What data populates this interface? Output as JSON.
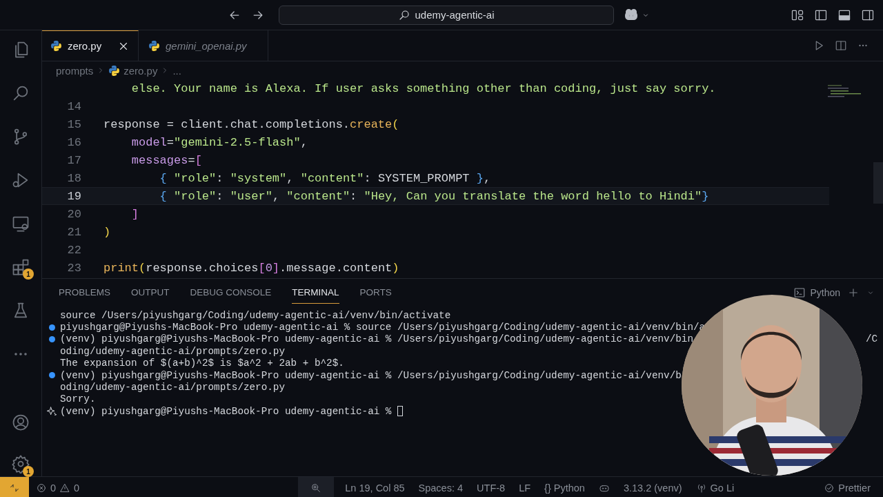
{
  "title_bar": {
    "search": "udemy-agentic-ai"
  },
  "activity_bar": {
    "items": [
      {
        "kind": "files",
        "selected": false
      },
      {
        "kind": "search",
        "selected": false
      },
      {
        "kind": "source-control",
        "selected": false
      },
      {
        "kind": "run",
        "selected": false
      },
      {
        "kind": "remote",
        "selected": false
      },
      {
        "kind": "extensions",
        "selected": false,
        "badge": "1"
      },
      {
        "kind": "testing",
        "selected": false
      },
      {
        "kind": "more",
        "selected": false
      }
    ],
    "bottom": [
      {
        "kind": "account"
      },
      {
        "kind": "settings",
        "badge": "1"
      }
    ]
  },
  "tabs": [
    {
      "label": "zero.py",
      "selected": true,
      "preview": false
    },
    {
      "label": "gemini_openai.py",
      "selected": false,
      "preview": true
    }
  ],
  "breadcrumb": [
    "prompts",
    "zero.py",
    "..."
  ],
  "editor": {
    "lines": [
      {
        "current": false,
        "tokens": [
          {
            "kind": "str",
            "text": "    else. Your name is Alexa. If user asks something other than coding, just say sorry."
          }
        ]
      },
      {
        "number": "14",
        "current": false
      },
      {
        "number": "15",
        "current": false,
        "tokens": [
          {
            "kind": "plain",
            "text": "response = client.chat.completions."
          },
          {
            "kind": "fn",
            "text": "create"
          },
          {
            "kind": "b1",
            "text": "("
          }
        ]
      },
      {
        "number": "16",
        "current": false,
        "tokens": [
          {
            "kind": "param",
            "text": "    model"
          },
          {
            "kind": "plain",
            "text": "="
          },
          {
            "kind": "str",
            "text": "\"gemini-2.5-flash\""
          },
          {
            "kind": "plain",
            "text": ","
          }
        ]
      },
      {
        "number": "17",
        "current": false,
        "tokens": [
          {
            "kind": "param",
            "text": "    messages"
          },
          {
            "kind": "plain",
            "text": "="
          },
          {
            "kind": "b2",
            "text": "["
          }
        ]
      },
      {
        "number": "18",
        "current": false,
        "tokens": [
          {
            "kind": "b3",
            "text": "        {"
          },
          {
            "kind": "str",
            "text": " \"role\""
          },
          {
            "kind": "plain",
            "text": ": "
          },
          {
            "kind": "str",
            "text": "\"system\""
          },
          {
            "kind": "plain",
            "text": ", "
          },
          {
            "kind": "str",
            "text": "\"content\""
          },
          {
            "kind": "plain",
            "text": ": SYSTEM_PROMPT "
          },
          {
            "kind": "b3",
            "text": "}"
          },
          {
            "kind": "plain",
            "text": ","
          }
        ]
      },
      {
        "number": "19",
        "current": true,
        "tokens": [
          {
            "kind": "b3",
            "text": "        {"
          },
          {
            "kind": "str",
            "text": " \"role\""
          },
          {
            "kind": "plain",
            "text": ": "
          },
          {
            "kind": "str",
            "text": "\"user\""
          },
          {
            "kind": "plain",
            "text": ", "
          },
          {
            "kind": "str",
            "text": "\"content\""
          },
          {
            "kind": "plain",
            "text": ": "
          },
          {
            "kind": "str",
            "text": "\"Hey, Can you translate the word hello to Hindi\""
          },
          {
            "kind": "b3",
            "text": "}"
          }
        ]
      },
      {
        "number": "20",
        "current": false,
        "tokens": [
          {
            "kind": "b2",
            "text": "    ]"
          }
        ]
      },
      {
        "number": "21",
        "current": false,
        "tokens": [
          {
            "kind": "b1",
            "text": ")"
          }
        ]
      },
      {
        "number": "22",
        "current": false
      },
      {
        "number": "23",
        "current": false,
        "tokens": [
          {
            "kind": "fn",
            "text": "print"
          },
          {
            "kind": "b1",
            "text": "("
          },
          {
            "kind": "plain",
            "text": "response.choices"
          },
          {
            "kind": "b2",
            "text": "["
          },
          {
            "kind": "num",
            "text": "0"
          },
          {
            "kind": "b2",
            "text": "]"
          },
          {
            "kind": "plain",
            "text": ".message.content"
          },
          {
            "kind": "b1",
            "text": ")"
          }
        ]
      }
    ]
  },
  "panel": {
    "tabs": [
      {
        "label": "PROBLEMS",
        "selected": false
      },
      {
        "label": "OUTPUT",
        "selected": false
      },
      {
        "label": "DEBUG CONSOLE",
        "selected": false
      },
      {
        "label": "TERMINAL",
        "selected": true
      },
      {
        "label": "PORTS",
        "selected": false
      }
    ],
    "shell": "Python"
  },
  "terminal": [
    {
      "kind": "output",
      "text": "source /Users/piyushgarg/Coding/udemy-agentic-ai/venv/bin/activate"
    },
    {
      "kind": "command",
      "color": "#3794ff",
      "text": "piyushgarg@Piyushs-MacBook-Pro udemy-agentic-ai % source /Users/piyushgarg/Coding/udemy-agentic-ai/venv/bin/a"
    },
    {
      "kind": "command",
      "color": "#3794ff",
      "text": "(venv) piyushgarg@Piyushs-MacBook-Pro udemy-agentic-ai % /Users/piyushgarg/Coding/udemy-agentic-ai/venv/bin",
      "tail": "/C"
    },
    {
      "kind": "output",
      "text": "oding/udemy-agentic-ai/prompts/zero.py"
    },
    {
      "kind": "output",
      "text": "The expansion of $(a+b)^2$ is $a^2 + 2ab + b^2$."
    },
    {
      "kind": "command",
      "color": "#3794ff",
      "text": "(venv) piyushgarg@Piyushs-MacBook-Pro udemy-agentic-ai % /Users/piyushgarg/Coding/udemy-agentic-ai/venv/b"
    },
    {
      "kind": "output",
      "text": "oding/udemy-agentic-ai/prompts/zero.py"
    },
    {
      "kind": "output",
      "text": "Sorry."
    },
    {
      "kind": "current",
      "text": "(venv) piyushgarg@Piyushs-MacBook-Pro udemy-agentic-ai % "
    }
  ],
  "status_bar": {
    "errors": "0",
    "warnings": "0",
    "items": [
      {
        "kind": "zoom"
      },
      {
        "kind": "text",
        "text": "Ln 19, Col 85"
      },
      {
        "kind": "text",
        "text": "Spaces: 4"
      },
      {
        "kind": "text",
        "text": "UTF-8"
      },
      {
        "kind": "text",
        "text": "LF"
      },
      {
        "kind": "text",
        "text": "{} Python"
      },
      {
        "kind": "copilot"
      },
      {
        "kind": "text",
        "text": "3.13.2 (venv)"
      },
      {
        "kind": "live",
        "text": "Go Li"
      }
    ],
    "right": "Prettier"
  },
  "webcam": {
    "kind": "picture"
  }
}
